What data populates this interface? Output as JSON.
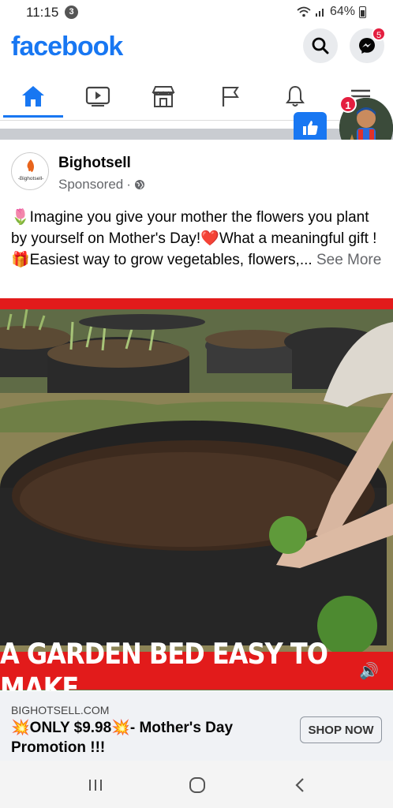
{
  "status_bar": {
    "time": "11:15",
    "notification_count": "3",
    "battery": "64%"
  },
  "header": {
    "logo": "facebook",
    "messenger_badge": "5"
  },
  "tabs": [
    {
      "name": "home",
      "icon": "home-icon",
      "active": true
    },
    {
      "name": "watch",
      "icon": "video-icon"
    },
    {
      "name": "marketplace",
      "icon": "store-icon"
    },
    {
      "name": "pages",
      "icon": "flag-icon"
    },
    {
      "name": "notifications",
      "icon": "bell-icon"
    },
    {
      "name": "menu",
      "icon": "hamburger-icon"
    }
  ],
  "chat_head": {
    "badge": "1"
  },
  "post": {
    "page_name": "Bighotsell",
    "avatar_text": "-Bighotsell-",
    "sponsored": "Sponsored",
    "text_emoji_1": "🌷",
    "text_part_1": "Imagine you give your mother the flowers you plant by yourself on Mother's Day!",
    "text_emoji_2": "❤️",
    "text_part_2": "What a meaningful gift ! ",
    "text_emoji_3": "🎁",
    "text_part_3": "Easiest way to grow vegetables, flowers,... ",
    "see_more": "See More",
    "video_caption": "A GARDEN BED EASY TO MAKE"
  },
  "cta": {
    "domain": "BIGHOTSELL.COM",
    "emoji": "💥",
    "title_part_1": "ONLY $9.98",
    "title_part_2": "- Mother's Day Promotion !!!",
    "button": "SHOP NOW"
  },
  "colors": {
    "brand": "#1877f2",
    "caption_red": "#e21b1b",
    "badge_red": "#e41e3f"
  }
}
